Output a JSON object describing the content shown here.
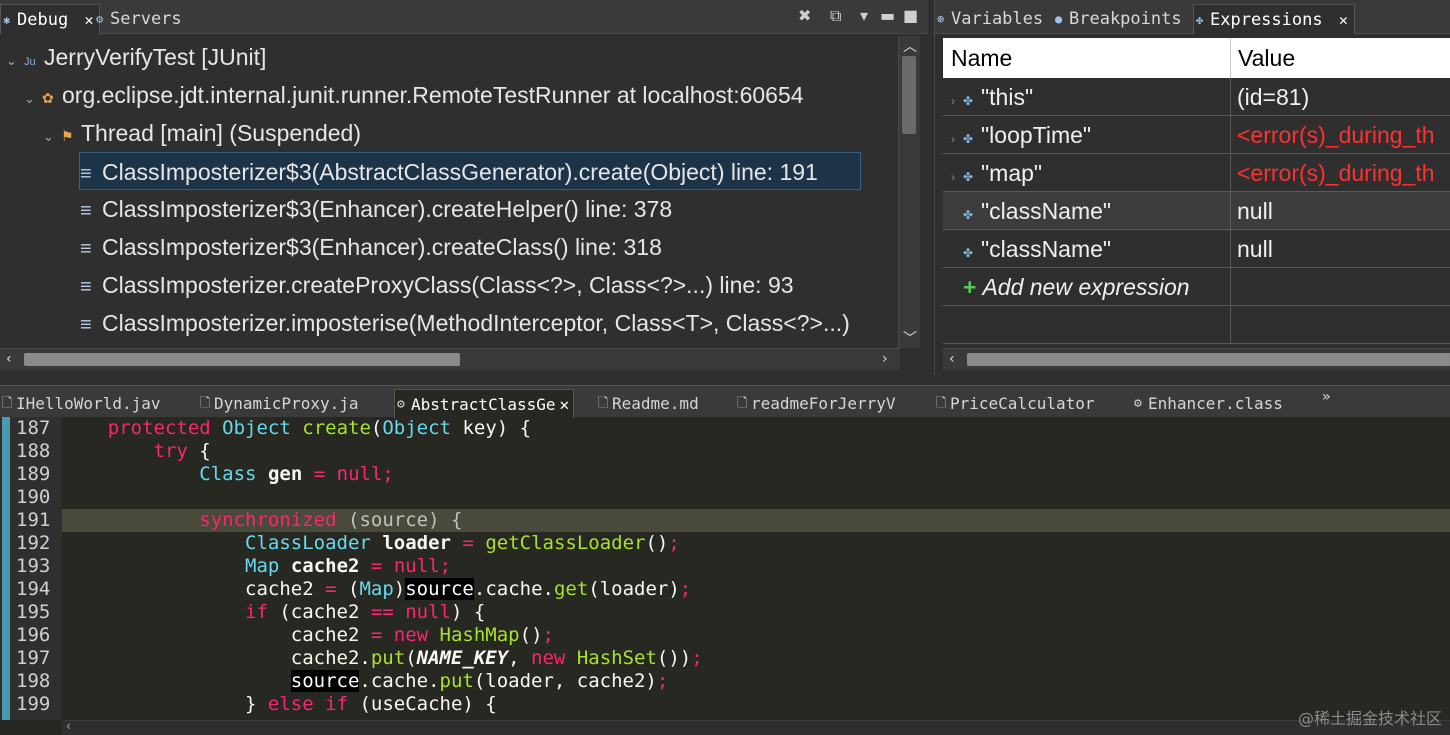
{
  "debug_view": {
    "tabs": [
      {
        "label": "Debug",
        "icon": "debug-icon",
        "closable": true
      },
      {
        "label": "Servers",
        "icon": "servers-icon",
        "closable": false
      }
    ],
    "tree": {
      "launch": "JerryVerifyTest [JUnit]",
      "target": "org.eclipse.jdt.internal.junit.runner.RemoteTestRunner at localhost:60654",
      "thread": "Thread [main] (Suspended)",
      "frames": [
        "ClassImposterizer$3(AbstractClassGenerator).create(Object) line: 191",
        "ClassImposterizer$3(Enhancer).createHelper() line: 378",
        "ClassImposterizer$3(Enhancer).createClass() line: 318",
        "ClassImposterizer.createProxyClass(Class<?>, Class<?>...) line: 93",
        "ClassImposterizer.imposterise(MethodInterceptor, Class<T>, Class<?>...)"
      ],
      "selected_frame": 0
    }
  },
  "expressions_view": {
    "tabs": [
      {
        "label": "Variables",
        "icon": "variables-icon"
      },
      {
        "label": "Breakpoints",
        "icon": "breakpoints-icon"
      },
      {
        "label": "Expressions",
        "icon": "expressions-icon",
        "active": true
      }
    ],
    "columns": {
      "name": "Name",
      "value": "Value"
    },
    "rows": [
      {
        "name": "\"this\"",
        "value": "(id=81)",
        "error": false,
        "expandable": true
      },
      {
        "name": "\"loopTime\"",
        "value": "<error(s)_during_th",
        "error": true,
        "expandable": true
      },
      {
        "name": "\"map\"",
        "value": "<error(s)_during_th",
        "error": true,
        "expandable": true
      },
      {
        "name": "\"className\"",
        "value": "null",
        "error": false,
        "expandable": false
      },
      {
        "name": "\"className\"",
        "value": "null",
        "error": false,
        "expandable": false
      }
    ],
    "add_label": "Add new expression"
  },
  "editor": {
    "tabs": [
      {
        "label": "IHelloWorld.jav",
        "icon": "java-file-icon"
      },
      {
        "label": "DynamicProxy.ja",
        "icon": "java-file-icon"
      },
      {
        "label": "AbstractClassGe",
        "icon": "class-file-icon",
        "active": true
      },
      {
        "label": "Readme.md",
        "icon": "text-file-icon"
      },
      {
        "label": "readmeForJerryV",
        "icon": "text-file-icon"
      },
      {
        "label": "PriceCalculator",
        "icon": "text-file-icon"
      },
      {
        "label": "Enhancer.class",
        "icon": "class-file-icon"
      }
    ],
    "overflow": "»",
    "current_line": 191,
    "line_numbers": [
      "187",
      "188",
      "189",
      "190",
      "191",
      "192",
      "193",
      "194",
      "195",
      "196",
      "197",
      "198",
      "199"
    ]
  },
  "watermark": "@稀土掘金技术社区"
}
